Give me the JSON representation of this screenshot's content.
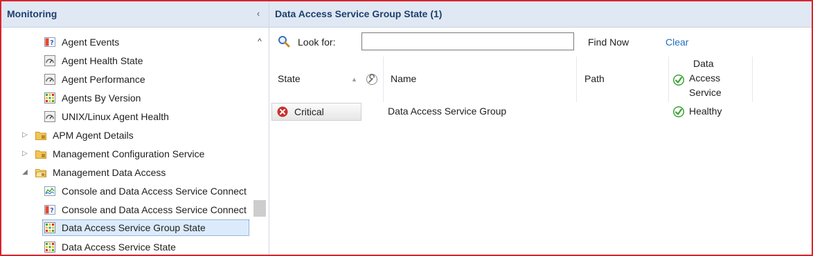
{
  "nav": {
    "title": "Monitoring",
    "collapse_glyph": "‹",
    "scroll_up_glyph": "^",
    "items": [
      {
        "label": "Agent Events",
        "icon": "event-view-icon"
      },
      {
        "label": "Agent Health State",
        "icon": "dashboard-gauge-icon"
      },
      {
        "label": "Agent Performance",
        "icon": "dashboard-gauge-icon"
      },
      {
        "label": "Agents By Version",
        "icon": "state-grid-icon"
      },
      {
        "label": "UNIX/Linux Agent Health",
        "icon": "dashboard-gauge-icon"
      },
      {
        "label": "APM Agent Details",
        "icon": "locked-folder-icon",
        "expander": "▷"
      },
      {
        "label": "Management Configuration Service",
        "icon": "locked-folder-icon",
        "expander": "▷"
      },
      {
        "label": "Management Data Access",
        "icon": "open-locked-folder-icon",
        "expander": "◢"
      },
      {
        "label": "Console and Data Access Service Connect",
        "icon": "performance-chart-icon"
      },
      {
        "label": "Console and Data Access Service Connect",
        "icon": "event-view-icon"
      },
      {
        "label": "Data Access Service Group State",
        "icon": "state-grid-icon",
        "selected": true
      },
      {
        "label": "Data Access Service State",
        "icon": "state-grid-icon"
      }
    ]
  },
  "content": {
    "title": "Data Access Service Group State (1)",
    "search": {
      "label": "Look for:",
      "value": "",
      "placeholder": "",
      "find_now": "Find Now",
      "clear": "Clear"
    },
    "columns": {
      "state": "State",
      "name": "Name",
      "path": "Path",
      "das_line1": "Data",
      "das_line2": "Access",
      "das_line3": "Service"
    },
    "sort_glyph": "▲",
    "rows": [
      {
        "state": "Critical",
        "name": "Data Access Service Group",
        "path": "",
        "das": "Healthy"
      }
    ]
  },
  "colors": {
    "frame_border": "#d9232e",
    "header_bg": "#dfe8f3",
    "header_text": "#1f3f6e",
    "link": "#1f6fc2",
    "critical": "#c8312b",
    "healthy": "#3aa335",
    "selected_bg": "#dcebfc"
  }
}
